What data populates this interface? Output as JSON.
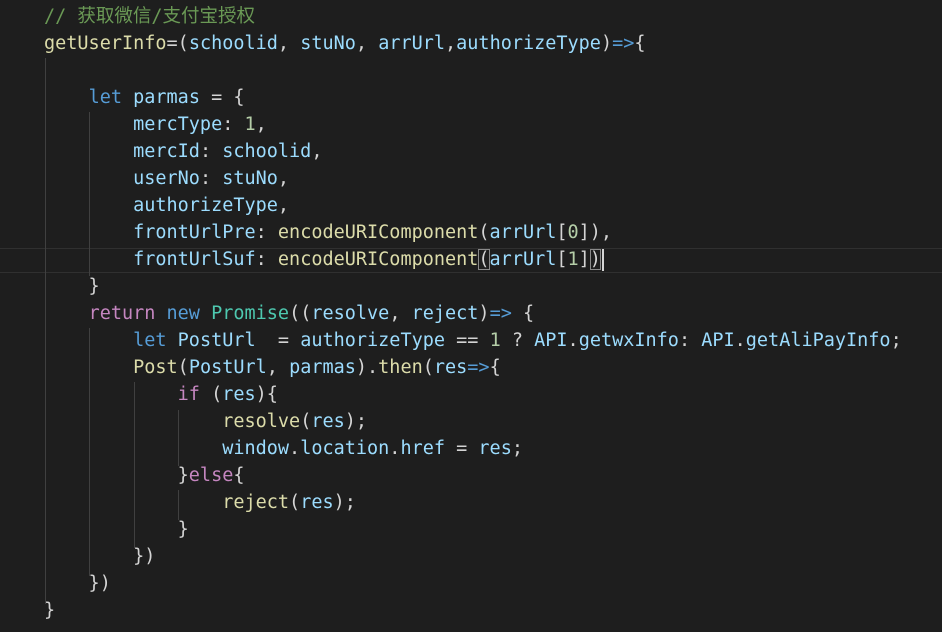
{
  "editor": {
    "theme_colors": {
      "background": "#1e1e1e",
      "comment": "#6a9955",
      "keyword": "#569cd6",
      "control": "#c586c0",
      "function": "#dcdcaa",
      "variable": "#9cdcfe",
      "number": "#b5cea8",
      "class": "#4ec9b0",
      "text": "#d4d4d4"
    },
    "lines": [
      [
        {
          "t": "// 获取微信/支付宝授权",
          "c": "comment"
        }
      ],
      [
        {
          "t": "getUserInfo",
          "c": "fn"
        },
        {
          "t": "=(",
          "c": "punc"
        },
        {
          "t": "schoolid",
          "c": "var"
        },
        {
          "t": ", ",
          "c": "punc"
        },
        {
          "t": "stuNo",
          "c": "var"
        },
        {
          "t": ", ",
          "c": "punc"
        },
        {
          "t": "arrUrl",
          "c": "var"
        },
        {
          "t": ",",
          "c": "punc"
        },
        {
          "t": "authorizeType",
          "c": "var"
        },
        {
          "t": ")",
          "c": "punc"
        },
        {
          "t": "=>",
          "c": "kw"
        },
        {
          "t": "{",
          "c": "punc"
        }
      ],
      [],
      [
        {
          "t": "    ",
          "c": "punc"
        },
        {
          "t": "let",
          "c": "kw"
        },
        {
          "t": " ",
          "c": "punc"
        },
        {
          "t": "parmas",
          "c": "var"
        },
        {
          "t": " = {",
          "c": "punc"
        }
      ],
      [
        {
          "t": "        ",
          "c": "punc"
        },
        {
          "t": "mercType",
          "c": "var"
        },
        {
          "t": ": ",
          "c": "punc"
        },
        {
          "t": "1",
          "c": "num"
        },
        {
          "t": ",",
          "c": "punc"
        }
      ],
      [
        {
          "t": "        ",
          "c": "punc"
        },
        {
          "t": "mercId",
          "c": "var"
        },
        {
          "t": ": ",
          "c": "punc"
        },
        {
          "t": "schoolid",
          "c": "var"
        },
        {
          "t": ",",
          "c": "punc"
        }
      ],
      [
        {
          "t": "        ",
          "c": "punc"
        },
        {
          "t": "userNo",
          "c": "var"
        },
        {
          "t": ": ",
          "c": "punc"
        },
        {
          "t": "stuNo",
          "c": "var"
        },
        {
          "t": ",",
          "c": "punc"
        }
      ],
      [
        {
          "t": "        ",
          "c": "punc"
        },
        {
          "t": "authorizeType",
          "c": "var"
        },
        {
          "t": ",",
          "c": "punc"
        }
      ],
      [
        {
          "t": "        ",
          "c": "punc"
        },
        {
          "t": "frontUrlPre",
          "c": "var"
        },
        {
          "t": ": ",
          "c": "punc"
        },
        {
          "t": "encodeURIComponent",
          "c": "fn"
        },
        {
          "t": "(",
          "c": "punc"
        },
        {
          "t": "arrUrl",
          "c": "var"
        },
        {
          "t": "[",
          "c": "punc"
        },
        {
          "t": "0",
          "c": "num"
        },
        {
          "t": "]),",
          "c": "punc"
        }
      ],
      [
        {
          "t": "        ",
          "c": "punc"
        },
        {
          "t": "frontUrlSuf",
          "c": "var"
        },
        {
          "t": ": ",
          "c": "punc"
        },
        {
          "t": "encodeURIComponent",
          "c": "fn"
        },
        {
          "t": "(",
          "c": "punc",
          "bm": true
        },
        {
          "t": "arrUrl",
          "c": "var"
        },
        {
          "t": "[",
          "c": "punc"
        },
        {
          "t": "1",
          "c": "num"
        },
        {
          "t": "]",
          "c": "punc"
        },
        {
          "t": ")",
          "c": "punc",
          "bm": true,
          "cursor": true
        }
      ],
      [
        {
          "t": "    }",
          "c": "punc"
        }
      ],
      [
        {
          "t": "    ",
          "c": "punc"
        },
        {
          "t": "return",
          "c": "ctrl"
        },
        {
          "t": " ",
          "c": "punc"
        },
        {
          "t": "new",
          "c": "kw"
        },
        {
          "t": " ",
          "c": "punc"
        },
        {
          "t": "Promise",
          "c": "cls"
        },
        {
          "t": "((",
          "c": "punc"
        },
        {
          "t": "resolve",
          "c": "var"
        },
        {
          "t": ", ",
          "c": "punc"
        },
        {
          "t": "reject",
          "c": "var"
        },
        {
          "t": ")",
          "c": "punc"
        },
        {
          "t": "=>",
          "c": "kw"
        },
        {
          "t": " {",
          "c": "punc"
        }
      ],
      [
        {
          "t": "        ",
          "c": "punc"
        },
        {
          "t": "let",
          "c": "kw"
        },
        {
          "t": " ",
          "c": "punc"
        },
        {
          "t": "PostUrl",
          "c": "var"
        },
        {
          "t": "  = ",
          "c": "punc"
        },
        {
          "t": "authorizeType",
          "c": "var"
        },
        {
          "t": " == ",
          "c": "punc"
        },
        {
          "t": "1",
          "c": "num"
        },
        {
          "t": " ? ",
          "c": "punc"
        },
        {
          "t": "API",
          "c": "var"
        },
        {
          "t": ".",
          "c": "punc"
        },
        {
          "t": "getwxInfo",
          "c": "var"
        },
        {
          "t": ": ",
          "c": "punc"
        },
        {
          "t": "API",
          "c": "var"
        },
        {
          "t": ".",
          "c": "punc"
        },
        {
          "t": "getAliPayInfo",
          "c": "var"
        },
        {
          "t": ";",
          "c": "punc"
        }
      ],
      [
        {
          "t": "        ",
          "c": "punc"
        },
        {
          "t": "Post",
          "c": "fn"
        },
        {
          "t": "(",
          "c": "punc"
        },
        {
          "t": "PostUrl",
          "c": "var"
        },
        {
          "t": ", ",
          "c": "punc"
        },
        {
          "t": "parmas",
          "c": "var"
        },
        {
          "t": ").",
          "c": "punc"
        },
        {
          "t": "then",
          "c": "fn"
        },
        {
          "t": "(",
          "c": "punc"
        },
        {
          "t": "res",
          "c": "var"
        },
        {
          "t": "=>",
          "c": "kw"
        },
        {
          "t": "{",
          "c": "punc"
        }
      ],
      [
        {
          "t": "            ",
          "c": "punc"
        },
        {
          "t": "if",
          "c": "ctrl"
        },
        {
          "t": " (",
          "c": "punc"
        },
        {
          "t": "res",
          "c": "var"
        },
        {
          "t": "){",
          "c": "punc"
        }
      ],
      [
        {
          "t": "                ",
          "c": "punc"
        },
        {
          "t": "resolve",
          "c": "fn"
        },
        {
          "t": "(",
          "c": "punc"
        },
        {
          "t": "res",
          "c": "var"
        },
        {
          "t": ");",
          "c": "punc"
        }
      ],
      [
        {
          "t": "                ",
          "c": "punc"
        },
        {
          "t": "window",
          "c": "var"
        },
        {
          "t": ".",
          "c": "punc"
        },
        {
          "t": "location",
          "c": "var"
        },
        {
          "t": ".",
          "c": "punc"
        },
        {
          "t": "href",
          "c": "var"
        },
        {
          "t": " = ",
          "c": "punc"
        },
        {
          "t": "res",
          "c": "var"
        },
        {
          "t": ";",
          "c": "punc"
        }
      ],
      [
        {
          "t": "            }",
          "c": "punc"
        },
        {
          "t": "else",
          "c": "ctrl"
        },
        {
          "t": "{",
          "c": "punc"
        }
      ],
      [
        {
          "t": "                ",
          "c": "punc"
        },
        {
          "t": "reject",
          "c": "fn"
        },
        {
          "t": "(",
          "c": "punc"
        },
        {
          "t": "res",
          "c": "var"
        },
        {
          "t": ");",
          "c": "punc"
        }
      ],
      [
        {
          "t": "            }",
          "c": "punc"
        }
      ],
      [
        {
          "t": "        })",
          "c": "punc"
        }
      ],
      [
        {
          "t": "    })",
          "c": "punc"
        }
      ],
      [
        {
          "t": "}",
          "c": "punc"
        }
      ]
    ]
  }
}
